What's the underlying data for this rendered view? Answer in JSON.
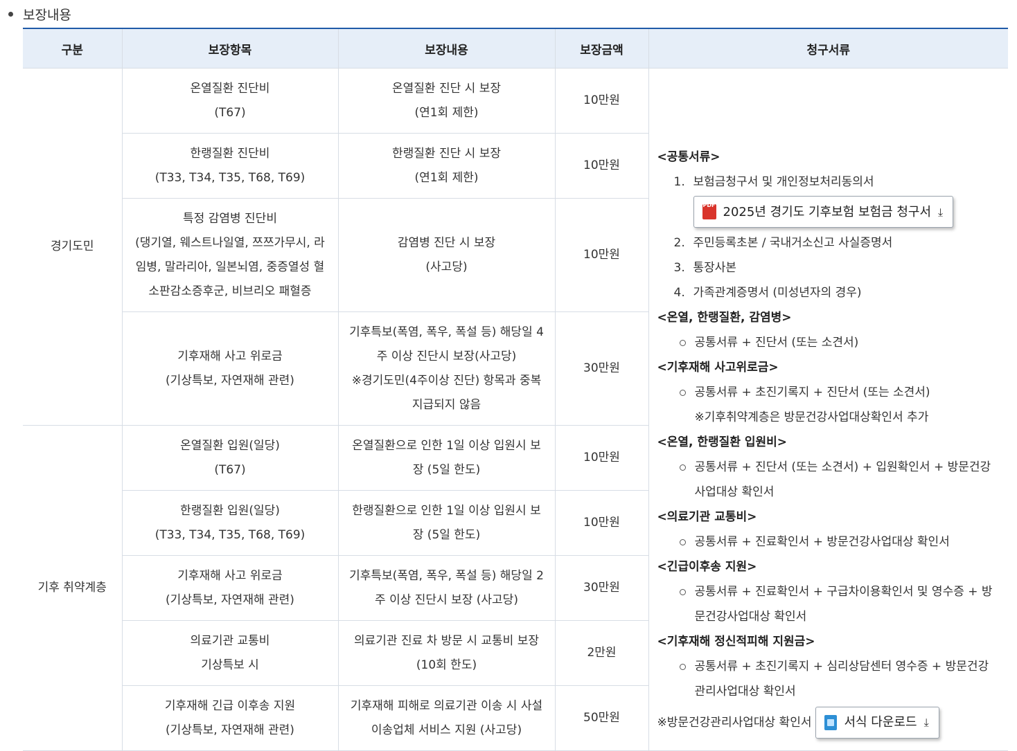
{
  "section": {
    "title": "보장내용"
  },
  "table": {
    "headers": [
      "구분",
      "보장항목",
      "보장내용",
      "보장금액",
      "청구서류"
    ],
    "groups": [
      "경기도민",
      "기후 취약계층"
    ],
    "rows": [
      {
        "item": [
          "온열질환 진단비",
          "(T67)"
        ],
        "content": [
          "온열질환 진단 시 보장",
          "(연1회 제한)"
        ],
        "amount": "10만원"
      },
      {
        "item": [
          "한랭질환 진단비",
          "(T33, T34, T35, T68, T69)"
        ],
        "content": [
          "한랭질환 진단 시 보장",
          "(연1회 제한)"
        ],
        "amount": "10만원"
      },
      {
        "item": [
          "특정 감염병 진단비",
          "(댕기열, 웨스트나일열, 쯔쯔가무시, 라",
          "임병, 말라리아, 일본뇌염, 중증열성 혈",
          "소판감소증후군, 비브리오 패혈증"
        ],
        "content": [
          "감염병 진단 시 보장",
          "(사고당)"
        ],
        "amount": "10만원"
      },
      {
        "item": [
          "기후재해 사고 위로금",
          "(기상특보, 자연재해 관련)"
        ],
        "content": [
          "기후특보(폭염, 폭우, 폭설 등) 해당일 4",
          "주 이상 진단시 보장(사고당)",
          "※경기도민(4주이상 진단) 항목과 중복",
          "지급되지 않음"
        ],
        "amount": "30만원"
      },
      {
        "item": [
          "온열질환 입원(일당)",
          "(T67)"
        ],
        "content": [
          "온열질환으로 인한 1일 이상 입원시 보",
          "장 (5일 한도)"
        ],
        "amount": "10만원"
      },
      {
        "item": [
          "한랭질환 입원(일당)",
          "(T33, T34, T35, T68, T69)"
        ],
        "content": [
          "한랭질환으로 인한 1일 이상 입원시 보",
          "장 (5일 한도)"
        ],
        "amount": "10만원"
      },
      {
        "item": [
          "기후재해 사고 위로금",
          "(기상특보, 자연재해 관련)"
        ],
        "content": [
          "기후특보(폭염, 폭우, 폭설 등) 해당일 2",
          "주 이상 진단시 보장 (사고당)"
        ],
        "amount": "30만원"
      },
      {
        "item": [
          "의료기관 교통비",
          "기상특보 시"
        ],
        "content": [
          "의료기관 진료 차 방문 시 교통비 보장",
          "(10회 한도)"
        ],
        "amount": "2만원"
      },
      {
        "item": [
          "기후재해 긴급 이후송 지원",
          "(기상특보, 자연재해 관련)"
        ],
        "content": [
          "기후재해 피해로 의료기관 이송 시 사설",
          "이송업체 서비스 지원 (사고당)"
        ],
        "amount": "50만원"
      }
    ]
  },
  "docs": {
    "common_title": "<공통서류>",
    "common_items": [
      {
        "num": "1.",
        "text": "보험금청구서 및 개인정보처리동의서"
      },
      {
        "num": "2.",
        "text": "주민등록초본 / 국내거소신고 사실증명서"
      },
      {
        "num": "3.",
        "text": "통장사본"
      },
      {
        "num": "4.",
        "text": "가족관계증명서 (미성년자의 경우)"
      }
    ],
    "claim_button": "2025년 경기도 기후보험 보험금 청구서",
    "sections": [
      {
        "title": "<온열, 한랭질환, 감염병>",
        "items": [
          "공통서류 + 진단서 (또는 소견서)"
        ]
      },
      {
        "title": "<기후재해 사고위로금>",
        "items": [
          "공통서류 + 초진기록지 + 진단서 (또는 소견서)"
        ],
        "note": "※기후취약계층은 방문건강사업대상확인서 추가"
      },
      {
        "title": "<온열, 한랭질환 입원비>",
        "items": [
          "공통서류 + 진단서 (또는 소견서) + 입원확인서 + 방문건강",
          "사업대상 확인서"
        ]
      },
      {
        "title": "<의료기관 교통비>",
        "items": [
          "공통서류 + 진료확인서 + 방문건강사업대상 확인서"
        ]
      },
      {
        "title": "<긴급이후송 지원>",
        "items": [
          "공통서류 + 진료확인서 + 구급차이용확인서 및 영수증 + 방",
          "문건강사업대상 확인서"
        ]
      },
      {
        "title": "<기후재해 정신적피해 지원금>",
        "items": [
          "공통서류 + 초진기록지 + 심리상담센터 영수증 + 방문건강",
          "관리사업대상 확인서"
        ]
      }
    ],
    "footer_note": "※방문건강관리사업대상 확인서",
    "form_button": "서식 다운로드"
  }
}
